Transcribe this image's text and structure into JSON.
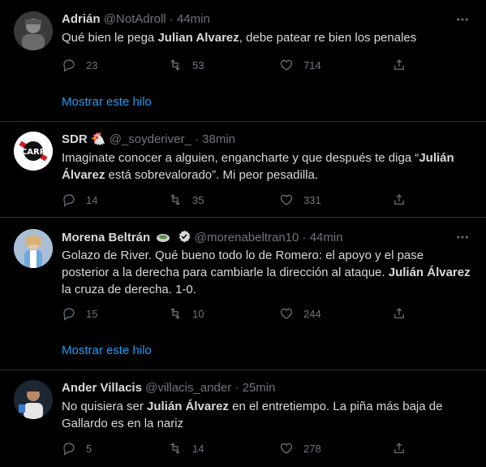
{
  "tweets": [
    {
      "name": "Adrián",
      "handle": "@NotAdroll",
      "dot": "·",
      "time": "44min",
      "text_parts": [
        "Qué bien le pega ",
        "Julian Alvarez",
        ", debe patear re bien los penales"
      ],
      "reply": "23",
      "retweet": "53",
      "like": "714",
      "thread_link": "Mostrar este hilo"
    },
    {
      "name": "SDR",
      "name_emoji": "🐔",
      "handle": "@_soyderiver_",
      "dot": "·",
      "time": "38min",
      "text_parts": [
        "Imaginate conocer a alguien, engancharte  y que después te diga “",
        "Julián Álvarez",
        " está sobrevalorado”. Mi peor pesadilla."
      ],
      "reply": "14",
      "retweet": "35",
      "like": "331"
    },
    {
      "name": "Morena Beltrán",
      "handle": "@morenabeltran10",
      "dot": "·",
      "time": "44min",
      "text_parts": [
        "Golazo de River. Qué bueno todo lo de Romero: el apoyo y el pase posterior a la derecha para cambiarle la dirección al ataque. ",
        "Julián Álvarez",
        " la cruza de derecha. 1-0."
      ],
      "reply": "15",
      "retweet": "10",
      "like": "244",
      "thread_link": "Mostrar este hilo"
    },
    {
      "name": "Ander Villacis",
      "handle": "@villacis_ander",
      "dot": "·",
      "time": "25min",
      "text_parts": [
        "No quisiera ser ",
        "Julián Álvarez",
        " en el entretiempo. La piña más baja de Gallardo es en la nariz"
      ],
      "reply": "5",
      "retweet": "14",
      "like": "278"
    }
  ],
  "colors": {
    "background": "#000000",
    "text": "#d9d9d9",
    "secondary": "#6e767d",
    "link": "#1d9bf0",
    "divider": "#2f3336",
    "verified": "#d9d9d9"
  },
  "icons": [
    "reply-icon",
    "retweet-icon",
    "like-icon",
    "share-icon",
    "more-icon",
    "verified-badge-icon"
  ]
}
